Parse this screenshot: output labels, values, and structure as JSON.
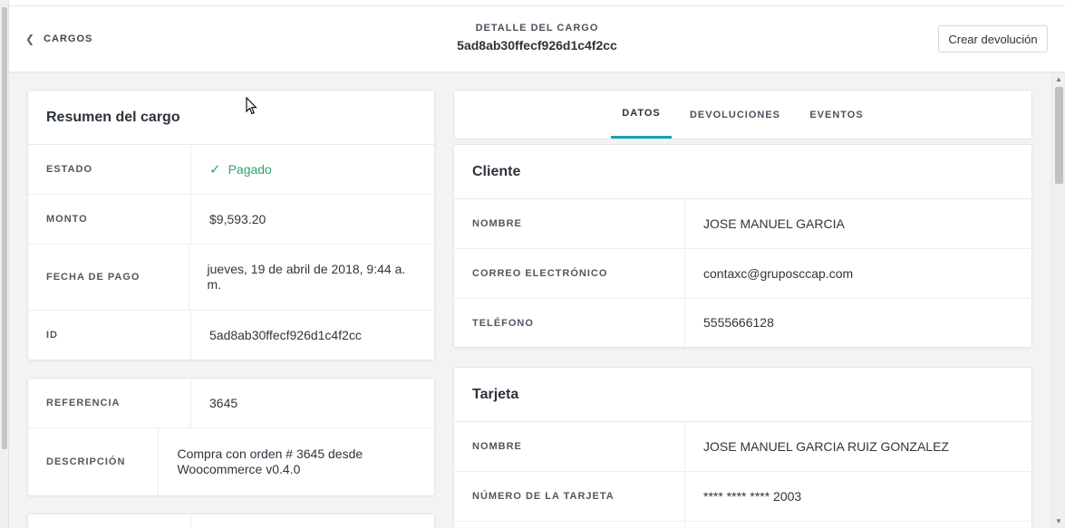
{
  "header": {
    "back_label": "CARGOS",
    "title_label": "DETALLE DEL CARGO",
    "charge_id": "5ad8ab30ffecf926d1c4f2cc",
    "refund_button": "Crear devolución"
  },
  "summary": {
    "title": "Resumen del cargo",
    "rows": [
      {
        "label": "ESTADO",
        "value": "Pagado"
      },
      {
        "label": "MONTO",
        "value": "$9,593.20"
      },
      {
        "label": "FECHA DE PAGO",
        "value": "jueves, 19 de abril de 2018, 9:44 a. m."
      },
      {
        "label": "ID",
        "value": "5ad8ab30ffecf926d1c4f2cc"
      }
    ]
  },
  "reference": {
    "rows": [
      {
        "label": "REFERENCIA",
        "value": "3645"
      },
      {
        "label": "DESCRIPCIÓN",
        "value": "Compra con orden # 3645 desde Woocommerce v0.4.0"
      }
    ]
  },
  "tabs": [
    {
      "label": "DATOS",
      "active": true
    },
    {
      "label": "DEVOLUCIONES",
      "active": false
    },
    {
      "label": "EVENTOS",
      "active": false
    }
  ],
  "customer": {
    "title": "Cliente",
    "rows": [
      {
        "label": "NOMBRE",
        "value": "JOSE MANUEL GARCIA"
      },
      {
        "label": "CORREO ELECTRÓNICO",
        "value": "contaxc@gruposccap.com"
      },
      {
        "label": "TELÉFONO",
        "value": "5555666128"
      }
    ]
  },
  "card": {
    "title": "Tarjeta",
    "rows": [
      {
        "label": "NOMBRE",
        "value": "JOSE MANUEL GARCIA RUIZ GONZALEZ"
      },
      {
        "label": "NÚMERO DE LA TARJETA",
        "value": "**** **** **** 2003"
      }
    ]
  },
  "colors": {
    "accent": "#1aa0b3",
    "status_paid": "#2fa36b",
    "background": "#f2f3f5"
  }
}
